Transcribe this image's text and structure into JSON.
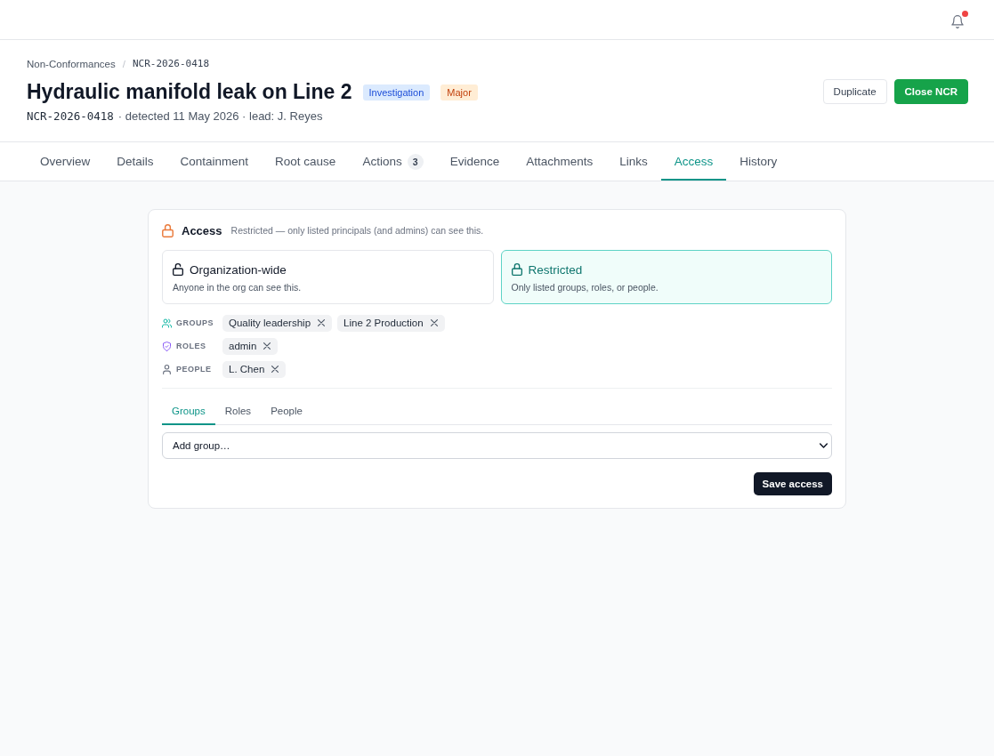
{
  "top_bar": {
    "notifications": {
      "unread": true
    }
  },
  "breadcrumb": {
    "items": [
      "Non-Conformances",
      "NCR-2026-0418"
    ],
    "separator": "/"
  },
  "header": {
    "title": "Hydraulic manifold leak on Line 2",
    "badges": [
      {
        "label": "Investigation",
        "kind": "status"
      },
      {
        "label": "Major",
        "kind": "severity"
      }
    ],
    "meta": {
      "id": "NCR-2026-0418",
      "details": "· detected 11 May 2026 · lead: J. Reyes"
    }
  },
  "actions": [
    {
      "label": "Duplicate",
      "kind": "secondary"
    },
    {
      "label": "Close NCR",
      "kind": "primary"
    }
  ],
  "tabs": [
    {
      "label": "Overview",
      "selected": false
    },
    {
      "label": "Details",
      "selected": false
    },
    {
      "label": "Containment",
      "selected": false
    },
    {
      "label": "Root cause",
      "selected": false
    },
    {
      "label": "Actions",
      "selected": false,
      "count": "3"
    },
    {
      "label": "Evidence",
      "selected": false
    },
    {
      "label": "Attachments",
      "selected": false
    },
    {
      "label": "Links",
      "selected": false
    },
    {
      "label": "Access",
      "selected": true
    },
    {
      "label": "History",
      "selected": false
    }
  ],
  "access": {
    "title": "Access",
    "summary": "Restricted — only listed principals (and admins) can see this.",
    "options": [
      {
        "kind": "open",
        "title": "Organization-wide",
        "description": "Anyone in the org can see this.",
        "selected": false
      },
      {
        "kind": "restricted",
        "title": "Restricted",
        "description": "Only listed groups, roles, or people.",
        "selected": true
      }
    ],
    "principals": [
      {
        "kind": "groups",
        "label": "GROUPS",
        "items": [
          "Quality leadership",
          "Line 2 Production"
        ]
      },
      {
        "kind": "roles",
        "label": "ROLES",
        "items": [
          "admin"
        ]
      },
      {
        "kind": "people",
        "label": "PEOPLE",
        "items": [
          "L. Chen"
        ]
      }
    ],
    "picker_tabs": [
      {
        "label": "Groups",
        "selected": true
      },
      {
        "label": "Roles",
        "selected": false
      },
      {
        "label": "People",
        "selected": false
      }
    ],
    "picker": {
      "value": "Add group…"
    },
    "save_button": "Save access"
  }
}
